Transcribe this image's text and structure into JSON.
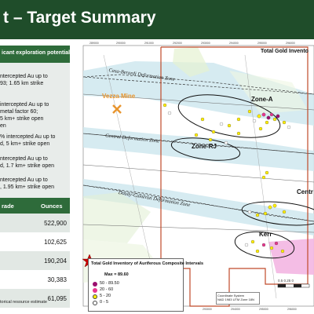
{
  "header": {
    "title": "t – Target Summary"
  },
  "left_panel": {
    "heading": "icant exploration potential",
    "items": [
      [
        "ntercepted Au up to",
        "93; 1.65 km strike"
      ],
      [
        "intercepted Au up to",
        "metal factor 60;",
        "5 km+ strike open",
        "en"
      ],
      [
        "% intercepted Au up to",
        "d, 5 km+ strike open"
      ],
      [
        "ntercepted Au up to",
        "d, 1.7 km+ strike open"
      ],
      [
        "ntercepted Au up to",
        ", 1.95 km+ strike open"
      ]
    ],
    "table": {
      "headers": [
        "rade",
        "Ounces"
      ],
      "rows": [
        "522,900",
        "102,625",
        "190,204",
        "30,383",
        "61,095"
      ]
    },
    "footnote": "torical resource estimate"
  },
  "map": {
    "title": "Total Gold Invento",
    "zones": [
      "Zone-A",
      "Zone-RJ",
      "Centr",
      "Kerr"
    ],
    "faults": [
      "Casa-Berardi Deformation Zone",
      "Central Deformation Zone",
      "Douay-Cameron Deformation Zone"
    ],
    "mine": "Vezza Mine",
    "top_ticks": [
      "289000",
      "290000",
      "291000",
      "292000",
      "293000",
      "294000",
      "295000",
      "296000",
      "297000"
    ],
    "bottom_ticks": [
      "289000",
      "290000",
      "291000",
      "292000",
      "293000",
      "294000",
      "295000",
      "296000"
    ],
    "legend": {
      "title": "Total Gold Inventory of Auriferous Composite Intervals",
      "entries": [
        {
          "label": "Max = 89.60",
          "color": "#cc0000"
        },
        {
          "label": "50 - 89.50",
          "color": "#9b0f6f"
        },
        {
          "label": "20 - 60",
          "color": "#e8368f"
        },
        {
          "label": "5 - 20",
          "color": "#ffee00"
        },
        {
          "label": "0 - 5",
          "color": "#ffffff"
        }
      ]
    },
    "coord_text": [
      "Coordinate System",
      "NAD 1983 UTM Zone 18N"
    ],
    "scale_text": "0.5 0.25 0",
    "colors": {
      "header_bg": "#1f4d2a",
      "table_head": "#2e6b3a",
      "property_outline": "#c04a2a",
      "deformation_band": "#cfe8ef",
      "fault_line": "#333333"
    }
  }
}
